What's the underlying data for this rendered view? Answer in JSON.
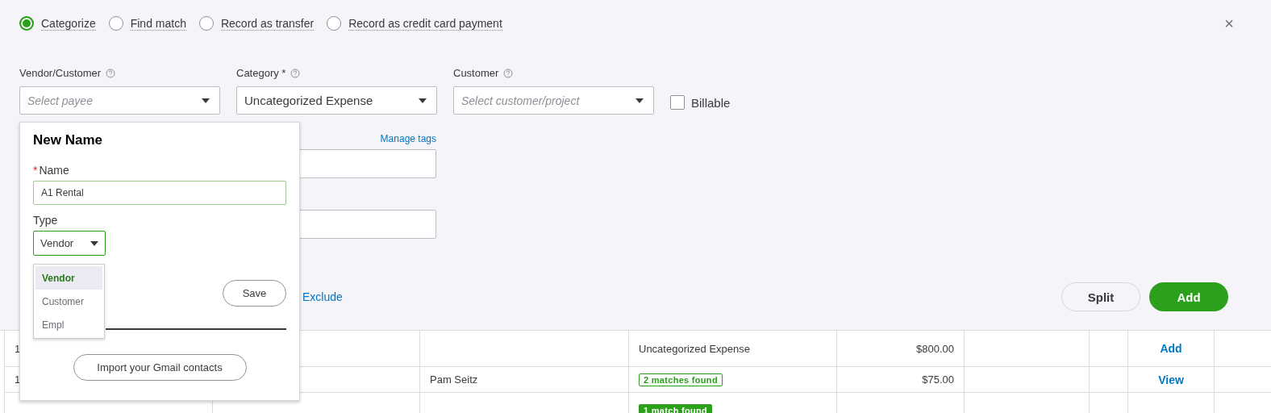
{
  "options": [
    {
      "label": "Categorize",
      "selected": true
    },
    {
      "label": "Find match",
      "selected": false
    },
    {
      "label": "Record as transfer",
      "selected": false
    },
    {
      "label": "Record as credit card payment",
      "selected": false
    }
  ],
  "close": "×",
  "fields": [
    {
      "label": "Vendor/Customer",
      "placeholder": "Select payee"
    },
    {
      "label": "Category *",
      "value": "Uncategorized Expense"
    },
    {
      "label": "Customer",
      "placeholder": "Select customer/project"
    }
  ],
  "billable": {
    "label": "Billable",
    "checked": false
  },
  "manage_tags": "Manage tags",
  "exclude": "Exclude",
  "split": "Split",
  "add": "Add",
  "table": {
    "rows": [
      {
        "column_1": "1",
        "category": {
          "kind": "text",
          "text": "Uncategorized Expense"
        },
        "amount": "$800.00",
        "action": "Add"
      },
      {
        "column_1": "1",
        "column_3": "Pam Seitz",
        "category": {
          "kind": "outline-badge",
          "text": "2 matches found"
        },
        "amount": "$75.00",
        "action": "View"
      },
      {
        "category": {
          "kind": "filled-badge",
          "text": "1 match found"
        }
      }
    ]
  },
  "popup": {
    "title": "New Name",
    "required_mark": "*",
    "name_label": "Name",
    "name_value": "A1 Rental",
    "type_label": "Type",
    "type_value": "Vendor",
    "type_options": [
      {
        "label": "Vendor",
        "selected": true
      },
      {
        "label": "Customer",
        "selected": false
      },
      {
        "label": "Empl",
        "selected": false
      }
    ],
    "save": "Save",
    "import": "Import your Gmail contacts"
  }
}
